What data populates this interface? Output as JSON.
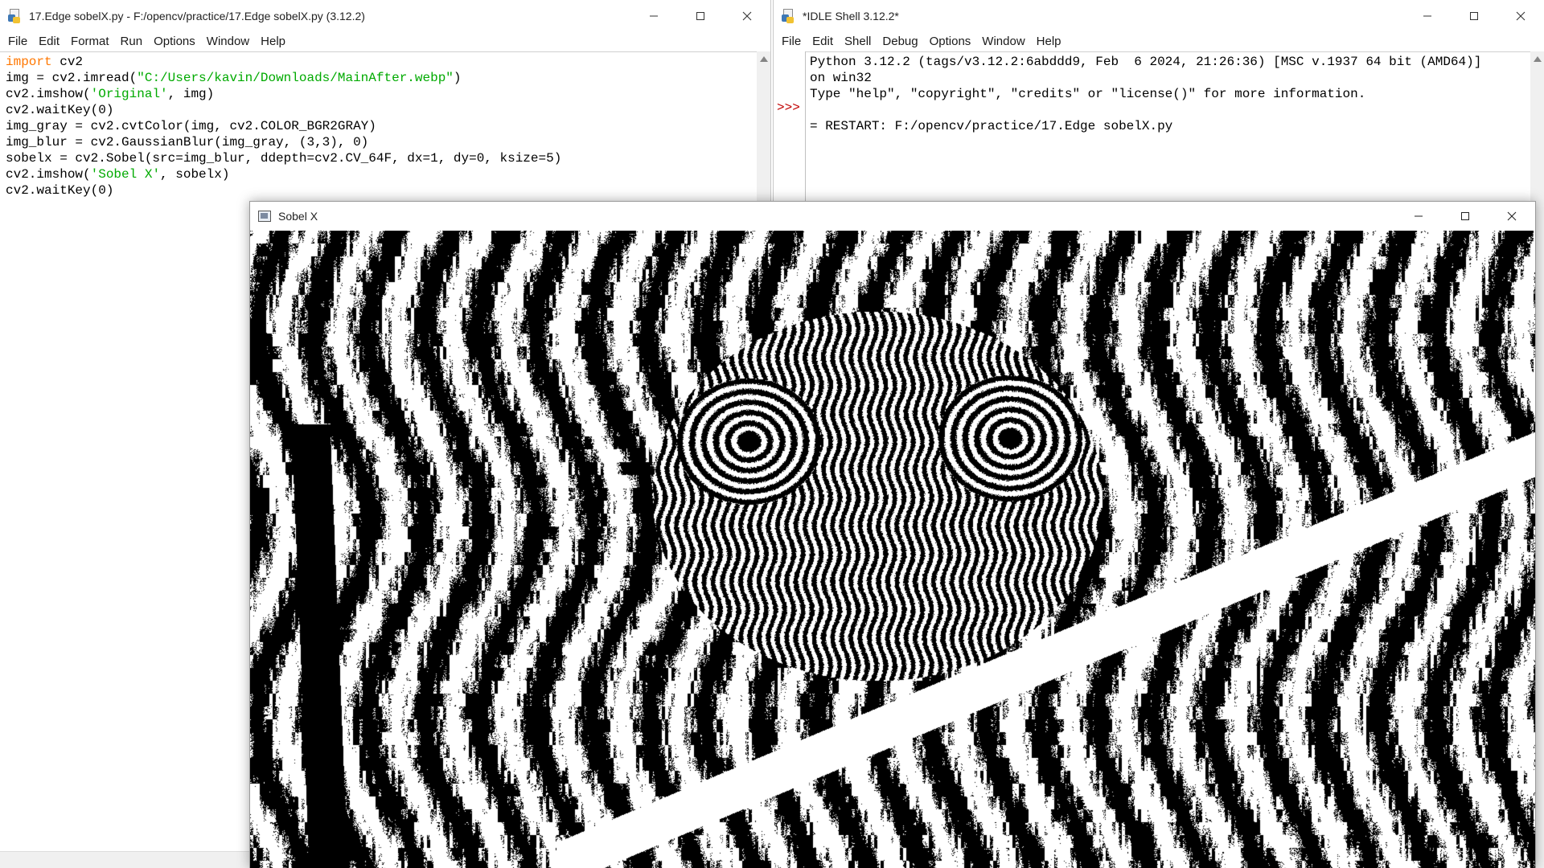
{
  "editor": {
    "title": "17.Edge sobelX.py - F:/opencv/practice/17.Edge sobelX.py (3.12.2)",
    "menu": [
      "File",
      "Edit",
      "Format",
      "Run",
      "Options",
      "Window",
      "Help"
    ],
    "code": [
      [
        {
          "t": "import",
          "c": "kw"
        },
        {
          "t": " cv2"
        }
      ],
      [
        {
          "t": "img = cv2.imread("
        },
        {
          "t": "\"C:/Users/kavin/Downloads/MainAfter.webp\"",
          "c": "str"
        },
        {
          "t": ")"
        }
      ],
      [
        {
          "t": "cv2.imshow("
        },
        {
          "t": "'Original'",
          "c": "str"
        },
        {
          "t": ", img)"
        }
      ],
      [
        {
          "t": "cv2.waitKey(0)"
        }
      ],
      [
        {
          "t": "img_gray = cv2.cvtColor(img, cv2.COLOR_BGR2GRAY)"
        }
      ],
      [
        {
          "t": "img_blur = cv2.GaussianBlur(img_gray, (3,3), 0)"
        }
      ],
      [
        {
          "t": "sobelx = cv2.Sobel(src=img_blur, ddepth=cv2.CV_64F, dx=1, dy=0, ksize=5)"
        }
      ],
      [
        {
          "t": "cv2.imshow("
        },
        {
          "t": "'Sobel X'",
          "c": "str"
        },
        {
          "t": ", sobelx)"
        }
      ],
      [
        {
          "t": "cv2.waitKey(0)"
        }
      ]
    ]
  },
  "shell": {
    "title": "*IDLE Shell 3.12.2*",
    "menu": [
      "File",
      "Edit",
      "Shell",
      "Debug",
      "Options",
      "Window",
      "Help"
    ],
    "prompt": ">>>",
    "lines": [
      "Python 3.12.2 (tags/v3.12.2:6abddd9, Feb  6 2024, 21:26:36) [MSC v.1937 64 bit (AMD64)]",
      "on win32",
      "Type \"help\", \"copyright\", \"credits\" or \"license()\" for more information.",
      "",
      "= RESTART: F:/opencv/practice/17.Edge sobelX.py"
    ]
  },
  "image_window": {
    "title": "Sobel X",
    "content": "Binary black-and-white Sobel X edge image of a chameleon-like lizard head among branches"
  },
  "icons": {
    "minimize": "minimize-icon",
    "maximize": "maximize-icon",
    "close": "close-icon"
  },
  "colors": {
    "keyword": "#ff7700",
    "string": "#00aa00",
    "prompt": "#c00000"
  }
}
